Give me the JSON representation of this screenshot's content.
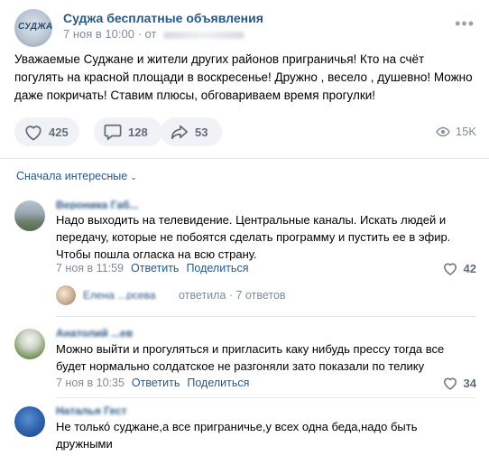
{
  "post": {
    "group_name": "Суджа бесплатные объявления",
    "group_logo_text": "СУДЖА",
    "date": "7 ноя в 10:00",
    "from_prefix": "· от",
    "text": "Уважаемые Суджане и жители других районов приграничья! Кто на счёт погулять на красной площади в воскресенье! Дружно , весело , душевно! Можно даже покричать! Ставим плюсы, обговариваем время прогулки!",
    "likes": "425",
    "comments": "128",
    "shares": "53",
    "views": "15K"
  },
  "comments_section": {
    "sort_label": "Сначала интересные"
  },
  "comments": [
    {
      "author": "Вероника Габ...",
      "text": "Надо выходить на телевидение. Центральные каналы. Искать людей и передачу, которые не побоятся сделать программу и пустить ее в эфир. Чтобы пошла огласка на всю страну.",
      "date": "7 ноя в 11:59",
      "reply_label": "Ответить",
      "share_label": "Поделиться",
      "likes": "42"
    },
    {
      "author": "Анатолий ...ев",
      "text": "Можно выйти и прогуляться и пригласить каку нибудь прессу тогда все будет нормально солдатское не разгоняли зато показали по телику",
      "date": "7 ноя в 10:35",
      "reply_label": "Ответить",
      "share_label": "Поделиться",
      "likes": "34"
    },
    {
      "author": "Наталья Гест",
      "text": "Не толькó суджане,а все приграничье,у всех одна беда,надо быть дружными"
    }
  ],
  "reply_thread": {
    "name": "Елена ...рсева",
    "status": "ответила · 7 ответов"
  },
  "colors": {
    "link": "#2a5885",
    "meta": "#818c99",
    "button_bg": "#f0f2f5",
    "divider": "#e7e8ec"
  }
}
